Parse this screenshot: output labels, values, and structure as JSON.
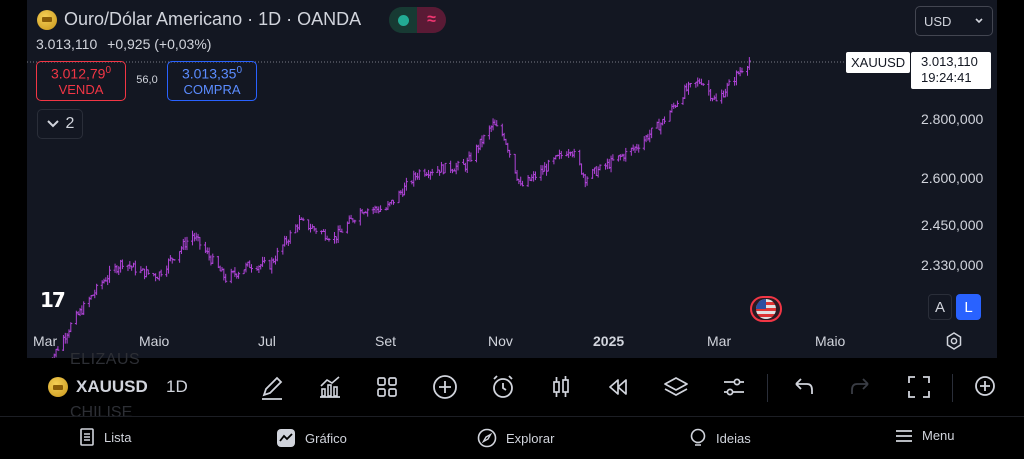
{
  "header": {
    "title": "Ouro/Dólar Americano · 1D · OANDA",
    "last_price": "3.013,110",
    "change": "+0,925 (+0,03%)"
  },
  "trade": {
    "sell_price_main": "3.012,79",
    "sell_price_sup": "0",
    "sell_label": "VENDA",
    "spread": "56,0",
    "buy_price_main": "3.013,35",
    "buy_price_sup": "0",
    "buy_label": "COMPRA"
  },
  "indicators_collapse": {
    "count": "2"
  },
  "currency": {
    "selected": "USD"
  },
  "price_scale": {
    "symbol": "XAUUSD",
    "current_price": "3.013,110",
    "countdown": "19:24:41",
    "ticks": [
      "2.800,000",
      "2.600,000",
      "2.450,000",
      "2.330,000"
    ]
  },
  "time_scale": {
    "ticks": [
      "Mar",
      "Maio",
      "Jul",
      "Set",
      "Nov",
      "2025",
      "Mar",
      "Maio"
    ]
  },
  "chart_data": {
    "type": "ohlc",
    "symbol": "XAUUSD",
    "interval": "1D",
    "scale": "log",
    "x": [
      "2024-03-01",
      "2024-03-15",
      "2024-04-01",
      "2024-04-12",
      "2024-04-22",
      "2024-05-01",
      "2024-05-20",
      "2024-06-07",
      "2024-06-20",
      "2024-07-01",
      "2024-07-17",
      "2024-08-05",
      "2024-08-20",
      "2024-09-02",
      "2024-09-20",
      "2024-10-01",
      "2024-10-15",
      "2024-10-30",
      "2024-11-05",
      "2024-11-14",
      "2024-11-25",
      "2024-12-11",
      "2024-12-19",
      "2025-01-02",
      "2025-01-15",
      "2025-01-30",
      "2025-02-11",
      "2025-02-20",
      "2025-02-28",
      "2025-03-14",
      "2025-03-18"
    ],
    "close": [
      2040,
      2160,
      2280,
      2340,
      2310,
      2300,
      2420,
      2290,
      2330,
      2330,
      2460,
      2410,
      2500,
      2500,
      2620,
      2630,
      2640,
      2780,
      2740,
      2570,
      2620,
      2700,
      2600,
      2650,
      2700,
      2790,
      2900,
      2940,
      2860,
      2985,
      3013
    ]
  },
  "toolbar": {
    "symbol": "XAUUSD",
    "interval": "1D",
    "ghost_top": "ELIZAUS",
    "ghost_bottom": "CHILISE"
  },
  "tradingview_logo": "17",
  "price_modes": {
    "auto": "A",
    "log": "L"
  },
  "bottom_nav": {
    "items": [
      {
        "label": "Lista"
      },
      {
        "label": "Gráfico"
      },
      {
        "label": "Explorar"
      },
      {
        "label": "Ideias"
      },
      {
        "label": "Menu"
      }
    ]
  },
  "colors": {
    "bg": "#131722",
    "candle": "#b044d8",
    "sell": "#f23645",
    "buy": "#2962ff",
    "accent": "#2962ff"
  }
}
